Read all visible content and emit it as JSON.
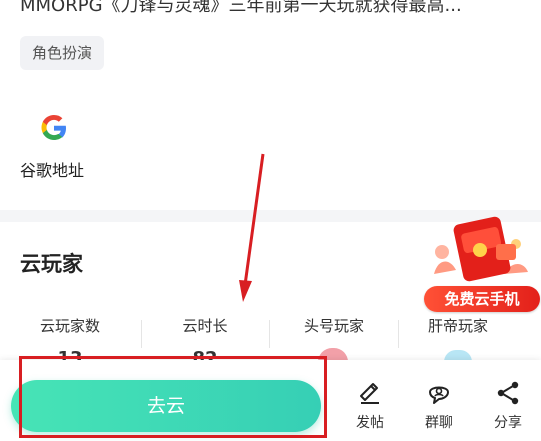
{
  "game": {
    "description": "MMORPG《刀锋与灵魂》三年前第一天玩就获得最高...",
    "tag": "角色扮演"
  },
  "links": {
    "google": {
      "label": "谷歌地址",
      "icon": "google-icon"
    }
  },
  "cloud_players": {
    "title": "云玩家",
    "columns": [
      {
        "label": "云玩家数",
        "value": "13"
      },
      {
        "label": "云时长",
        "value": "82"
      },
      {
        "label": "头号玩家",
        "value": ""
      },
      {
        "label": "肝帝玩家",
        "value": ""
      }
    ]
  },
  "promo": {
    "label": "免费云手机"
  },
  "bottom_bar": {
    "primary": "去云",
    "actions": [
      {
        "label": "发帖",
        "icon": "edit-icon"
      },
      {
        "label": "群聊",
        "icon": "chat-icon"
      },
      {
        "label": "分享",
        "icon": "share-icon"
      }
    ]
  },
  "colors": {
    "accent": "#3fd8b4",
    "highlight": "#d81e22",
    "promo": "#e3201a"
  }
}
